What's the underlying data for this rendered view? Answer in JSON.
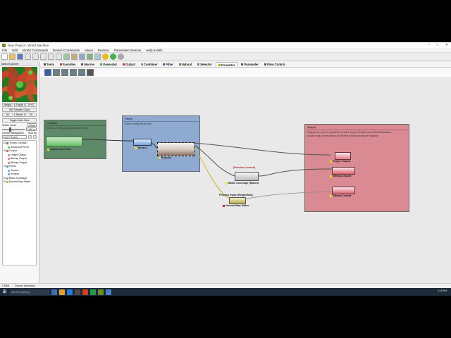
{
  "window": {
    "title": "New Project - World Machine"
  },
  "menu": [
    "File",
    "Edit",
    "World Commands",
    "Device Commands",
    "Views",
    "Devices",
    "Parameter Devices",
    "Help & Wiki"
  ],
  "left_panel": {
    "header": "Main Explorer",
    "view_buttons": [
      "Height",
      "Shade",
      "R+G"
    ],
    "set_preview_label": "Set Transfer Color",
    "small_buttons": [
      "3D",
      "Reset",
      "Fit"
    ],
    "toggle_label": "Toggle Main View",
    "water_level_label": "Water Level",
    "water_show_label": "Show",
    "water_value": "1190 m",
    "device_nav_label": "Device Navigation",
    "sort_label": "Sort by",
    "sort_value": "Live Preview",
    "tree": [
      {
        "label": "Terrain Creation",
        "indent": 0,
        "color": "#5a8f5a"
      },
      {
        "label": "Advanced Perlin",
        "indent": 1,
        "color": "#74c474"
      },
      {
        "label": "Output",
        "indent": 0,
        "color": "#c46a6a"
      },
      {
        "label": "Height Output",
        "indent": 1,
        "color": "#e09090"
      },
      {
        "label": "Bitmap Output",
        "indent": 1,
        "color": "#e09090"
      },
      {
        "label": "Bitmap Output",
        "indent": 1,
        "color": "#e09090"
      },
      {
        "label": "Filters",
        "indent": 0,
        "color": "#6c8fb4"
      },
      {
        "label": "Terrace",
        "indent": 1,
        "color": "#8fb0d6"
      },
      {
        "label": "Erosion",
        "indent": 1,
        "color": "#8fb0d6"
      },
      {
        "label": "Basic Coverage",
        "indent": 0,
        "color": "#999999"
      },
      {
        "label": "Normal Map Maker",
        "indent": 0,
        "color": "#c4b84a"
      }
    ]
  },
  "tabs": [
    {
      "label": "Tools",
      "color": "#444"
    },
    {
      "label": "Favorites",
      "color": "#c0392b"
    },
    {
      "label": "Macros",
      "color": "#555"
    },
    {
      "label": "Generator",
      "color": "#3a3"
    },
    {
      "label": "Output",
      "color": "#c33"
    },
    {
      "label": "Combiner",
      "color": "#888"
    },
    {
      "label": "Filter",
      "color": "#36a"
    },
    {
      "label": "Natural",
      "color": "#963"
    },
    {
      "label": "Selector",
      "color": "#777"
    },
    {
      "label": "Converter",
      "color": "#aa0",
      "active": true
    },
    {
      "label": "Parameter",
      "color": "#555"
    },
    {
      "label": "Flow Control",
      "color": "#555"
    }
  ],
  "groups": {
    "creation": {
      "title": "Creation",
      "desc": "Devices in this group generate terrain."
    },
    "filters": {
      "title": "Filters",
      "desc": "These modify the terrain."
    },
    "output": {
      "title": "Output",
      "desc": "Outputs are used to export the results of your terrains out of World Machine.\nDouble click on the device to set their format and export options."
    }
  },
  "nodes": {
    "perlin": "Advanced Perlin",
    "terrace": "Terrace",
    "erosion": "Erosion",
    "preview_locked": "(Preview Locked)",
    "basic_coverage": "Basic Coverage (Macro)",
    "primary_input": "Primary Input (Heightfield)",
    "normal_map": "Normal Map Maker",
    "height_output": "Height Output",
    "bitmap_output_1": "Bitmap Output",
    "bitmap_output_2": "Bitmap Output"
  },
  "status": [
    "7.5MB",
    "Device Workview"
  ],
  "taskbar": {
    "search": "Ask me anything",
    "time": "4:15 PM"
  },
  "colors": {
    "creation": "#5f8a6a",
    "filters": "#8eaad0",
    "output": "#d98a93",
    "wire": "#4a4a4a",
    "wire_yellow": "#c8b436"
  }
}
